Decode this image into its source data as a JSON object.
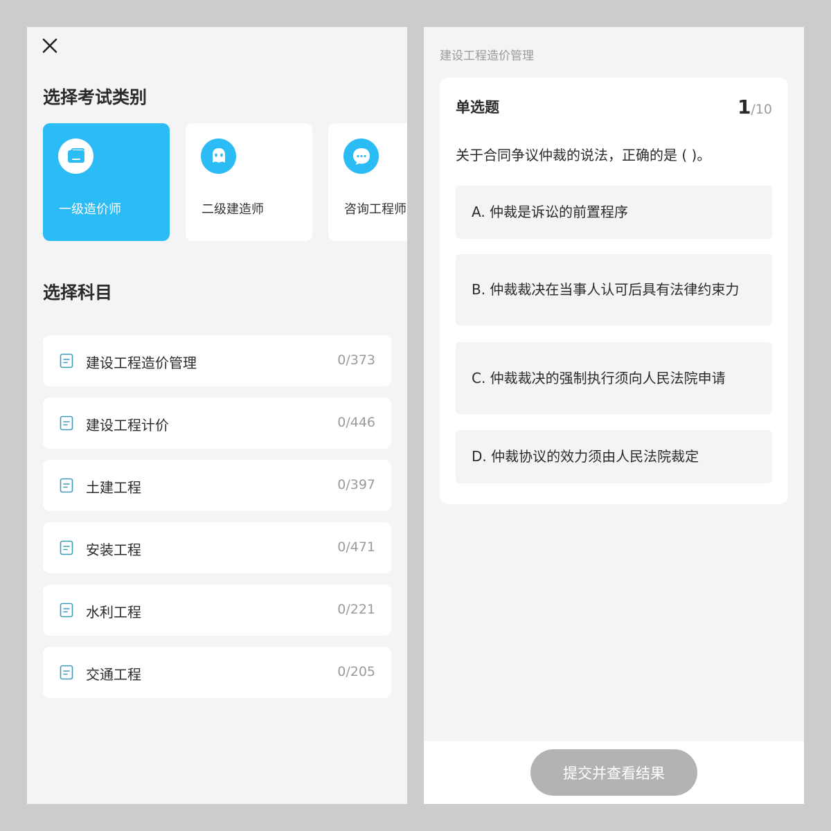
{
  "left": {
    "exam_section_title": "选择考试类别",
    "categories": [
      {
        "label": "一级造价师",
        "icon": "card-icon",
        "selected": true
      },
      {
        "label": "二级建造师",
        "icon": "face-icon",
        "selected": false
      },
      {
        "label": "咨询工程师",
        "icon": "chat-icon",
        "selected": false
      }
    ],
    "subject_section_title": "选择科目",
    "subjects": [
      {
        "name": "建设工程造价管理",
        "count": "0/373"
      },
      {
        "name": "建设工程计价",
        "count": "0/446"
      },
      {
        "name": "土建工程",
        "count": "0/397"
      },
      {
        "name": "安装工程",
        "count": "0/471"
      },
      {
        "name": "水利工程",
        "count": "0/221"
      },
      {
        "name": "交通工程",
        "count": "0/205"
      }
    ]
  },
  "right": {
    "subject_header": "建设工程造价管理",
    "question_type": "单选题",
    "counter_current": "1",
    "counter_total": "/10",
    "question_text": "关于合同争议仲裁的说法，正确的是 ( )。",
    "options": [
      "A. 仲裁是诉讼的前置程序",
      "B. 仲裁裁决在当事人认可后具有法律约束力",
      "C. 仲裁裁决的强制执行须向人民法院申请",
      "D. 仲裁协议的效力须由人民法院裁定"
    ],
    "submit_label": "提交并查看结果"
  },
  "colors": {
    "accent": "#2bbbf5",
    "icon_outline": "#3f9ab8",
    "submit_disabled": "#b3b3b3",
    "panel_bg": "#f4f4f4"
  }
}
